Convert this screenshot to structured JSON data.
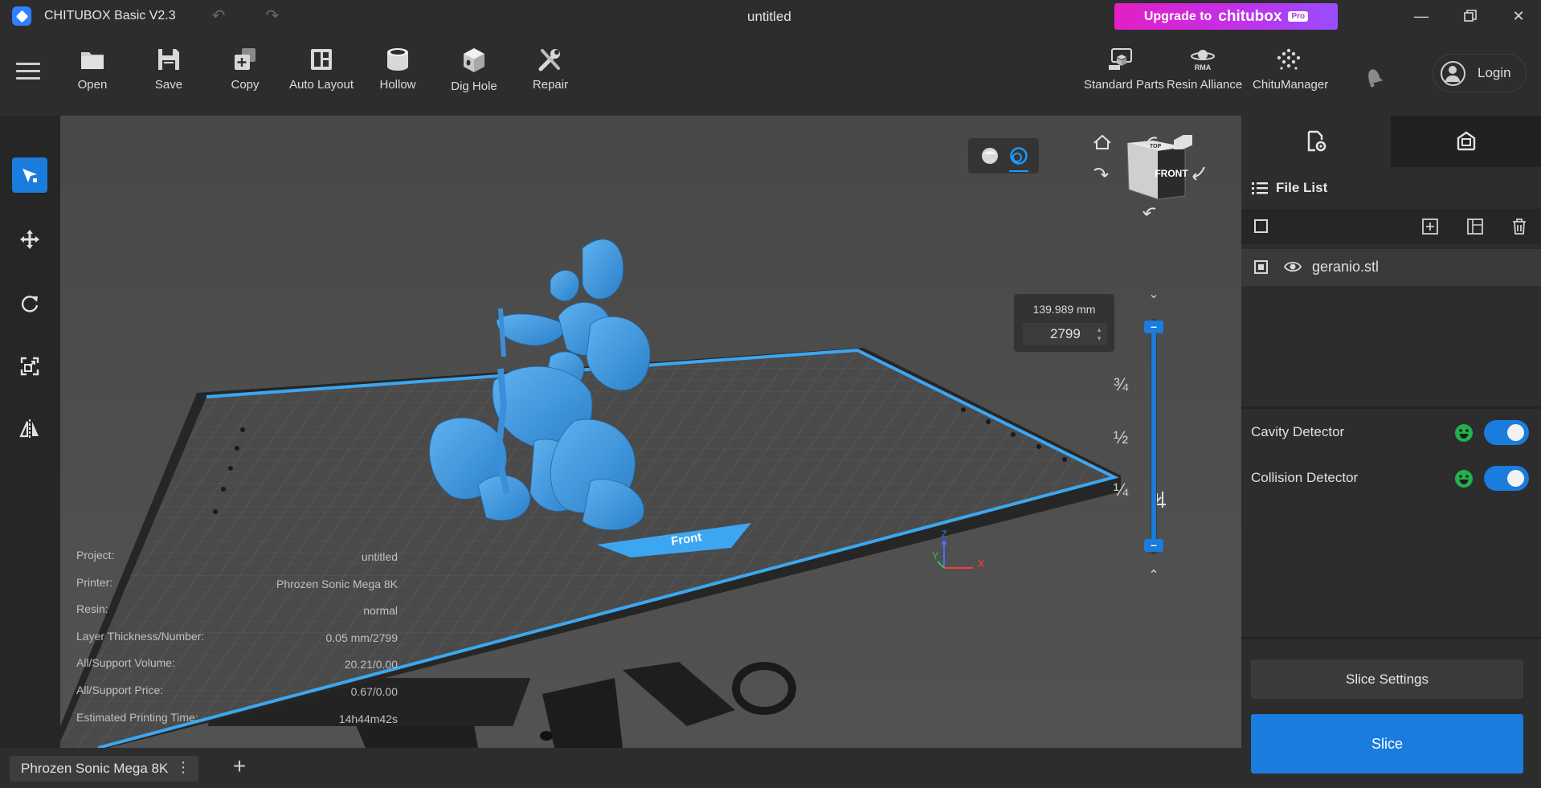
{
  "titlebar": {
    "app_title": "CHITUBOX Basic V2.3",
    "doc_title": "untitled",
    "upgrade": {
      "prefix": "Upgrade to",
      "brand": "chitubox",
      "badge": "Pro"
    }
  },
  "toolbar": {
    "left_tools": [
      {
        "label": "Open",
        "icon": "folder-icon"
      },
      {
        "label": "Save",
        "icon": "floppy-icon"
      },
      {
        "label": "Copy",
        "icon": "copy-plus-icon"
      },
      {
        "label": "Auto Layout",
        "icon": "layout-icon"
      },
      {
        "label": "Hollow",
        "icon": "cylinder-icon"
      },
      {
        "label": "Dig Hole",
        "icon": "cube-hole-icon"
      },
      {
        "label": "Repair",
        "icon": "wrench-icon"
      }
    ],
    "right_tools": [
      {
        "label": "Standard Parts",
        "icon": "parts-icon"
      },
      {
        "label": "Resin Alliance",
        "icon": "rma-icon",
        "icon_text": "RMA"
      },
      {
        "label": "ChituManager",
        "icon": "chitumanager-icon"
      }
    ],
    "login_label": "Login"
  },
  "left_sidebar": {
    "tools": [
      "select-icon",
      "move-icon",
      "rotate-icon",
      "scale-icon",
      "mirror-icon"
    ],
    "active_index": 0
  },
  "viewport": {
    "view_cube_label": "FRONT",
    "view_cube_top_label": "TOP",
    "plate_front_label": "Front",
    "height_mm": "139.989 mm",
    "layer_value": "2799",
    "fraction_marks": [
      "¾",
      "½",
      "¼"
    ],
    "axis_labels": {
      "x": "X",
      "y": "Y",
      "z": "Z"
    },
    "info": [
      {
        "key": "Project:",
        "value": "untitled"
      },
      {
        "key": "Printer:",
        "value": "Phrozen Sonic Mega 8K"
      },
      {
        "key": "Resin:",
        "value": "normal"
      },
      {
        "key": "Layer Thickness/Number:",
        "value": "0.05 mm/2799"
      },
      {
        "key": "All/Support Volume:",
        "value": "20.21/0.00"
      },
      {
        "key": "All/Support Price:",
        "value": "0.67/0.00"
      },
      {
        "key": "Estimated Printing Time:",
        "value": "14h44m42s"
      }
    ]
  },
  "tabbar": {
    "printer_tab": "Phrozen Sonic Mega 8K",
    "more_icon": "⋮",
    "add_icon": "+"
  },
  "right_panel": {
    "file_list_title": "File List",
    "files": [
      {
        "name": "geranio.stl",
        "selected": true,
        "visible": true
      }
    ],
    "detectors": [
      {
        "label": "Cavity Detector",
        "enabled": true
      },
      {
        "label": "Collision Detector",
        "enabled": true
      }
    ],
    "slice_settings_label": "Slice Settings",
    "slice_label": "Slice"
  },
  "colors": {
    "accent": "#1a7cdc",
    "model": "#3a96e0",
    "plate_border": "#3da6f0",
    "upgrade_gradient_start": "#e31fc3",
    "upgrade_gradient_end": "#9a4dff",
    "status_ok": "#22b14c"
  }
}
